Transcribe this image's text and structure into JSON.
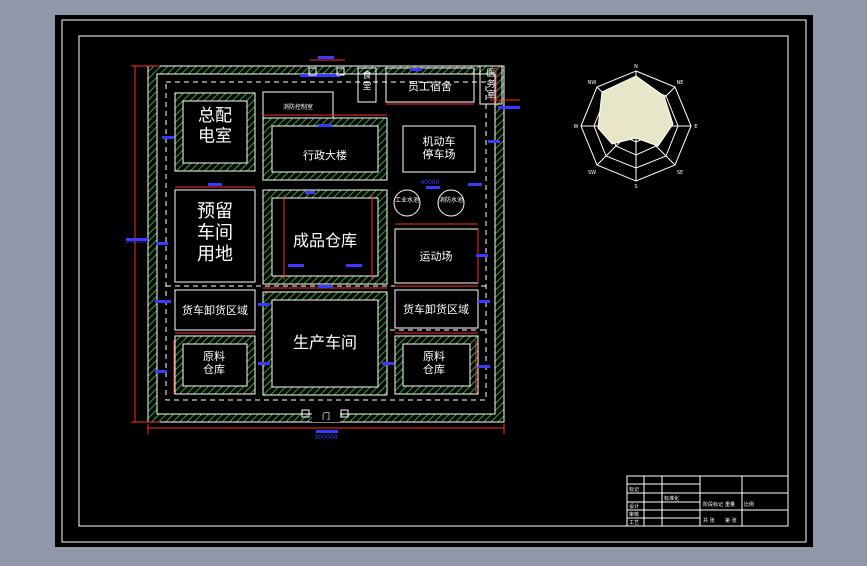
{
  "colors": {
    "background": "#8f97a8",
    "sheet": "#000000",
    "lines": "#ffffff",
    "hatch": "#2e9e2e",
    "dimension": "#ff2a2a",
    "dimension_text": "#3a3aff",
    "roses": "#e8e6c8"
  },
  "buildings": {
    "canteen": "食\n堂",
    "dormitory": "员工宿舍",
    "clinic": "医\n务\n室",
    "power_room": "总配\n电室",
    "fire_room": "消防控制室",
    "admin": "行政大楼",
    "parking": "机动车\n停车场",
    "reserve": "预留\n车间\n用地",
    "products": "成品仓库",
    "sport": "运动场",
    "unload_left": "货车卸货区域",
    "unload_right": "货车卸货区域",
    "production": "生产车间",
    "raw_left": "原料\n仓库",
    "raw_right": "原料\n仓库",
    "pool_left": "工业水池",
    "pool_right": "消防水池",
    "gate": "门"
  },
  "dimensions": {
    "total_width": "300000",
    "total_height": "300000",
    "pool_label": "40000"
  },
  "wind_rose": {
    "labels": [
      "N",
      "NE",
      "E",
      "SE",
      "S",
      "SW",
      "W",
      "NW"
    ]
  },
  "title_block": {
    "rows": [
      "标记",
      "设计",
      "审核",
      "工艺"
    ],
    "middle": "标准化",
    "bottom": [
      "阶段标记",
      "重量",
      "比例",
      "共 张",
      "第 张"
    ]
  }
}
